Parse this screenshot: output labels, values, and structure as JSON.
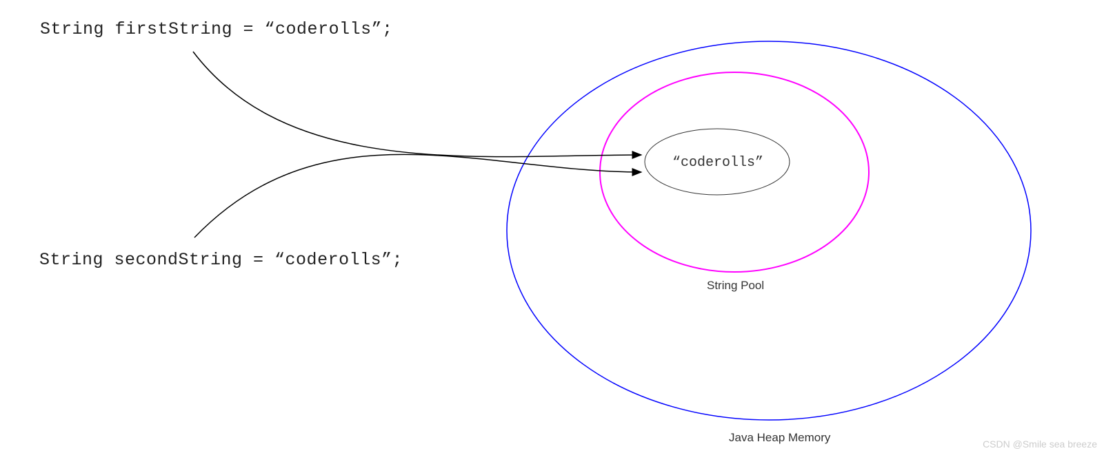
{
  "code": {
    "line1": "String firstString = “coderolls”;",
    "line2": "String secondString = “coderolls”;"
  },
  "pool": {
    "value": "“coderolls”",
    "label": "String Pool"
  },
  "heap": {
    "label": "Java Heap Memory"
  },
  "watermark": "CSDN @Smile sea breeze"
}
